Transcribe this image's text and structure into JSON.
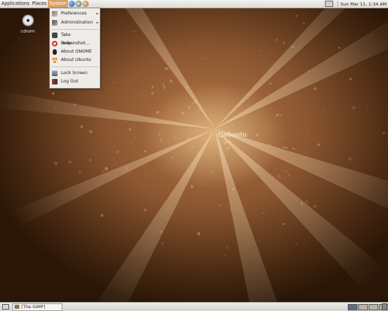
{
  "top_panel": {
    "menus": [
      {
        "label": "Applications"
      },
      {
        "label": "Places"
      },
      {
        "label": "System"
      }
    ],
    "launchers": [
      "browser-icon",
      "mail-icon",
      "help-icon"
    ],
    "clock": "Sun Mar 11,  1:34 AM"
  },
  "desktop": {
    "icons": [
      {
        "label": "cdrom",
        "icon": "cdrom-icon"
      }
    ],
    "wallpaper_text": "ubuntu"
  },
  "system_menu": {
    "items": [
      {
        "label": "Preferences",
        "icon": "preferences-icon",
        "submenu": true
      },
      {
        "label": "Administration",
        "icon": "administration-icon",
        "submenu": true
      },
      {
        "label": "Take Screenshot...",
        "icon": "camera-icon"
      },
      {
        "label": "Help",
        "icon": "help-icon"
      },
      {
        "label": "About GNOME",
        "icon": "gnome-icon"
      },
      {
        "label": "About Ubuntu",
        "icon": "ubuntu-icon"
      },
      {
        "label": "Lock Screen",
        "icon": "lock-icon"
      },
      {
        "label": "Log Out",
        "icon": "logout-icon"
      }
    ],
    "submenu_arrow": "▸"
  },
  "bottom_panel": {
    "tasks": [
      {
        "label": "[The GIMP]",
        "icon": "gimp-icon"
      }
    ],
    "workspaces": 4,
    "active_workspace": 1
  },
  "colors": {
    "panel": "#dcdad5",
    "menu_highlight": "#d9a066",
    "wallpaper": "#8a5530"
  }
}
